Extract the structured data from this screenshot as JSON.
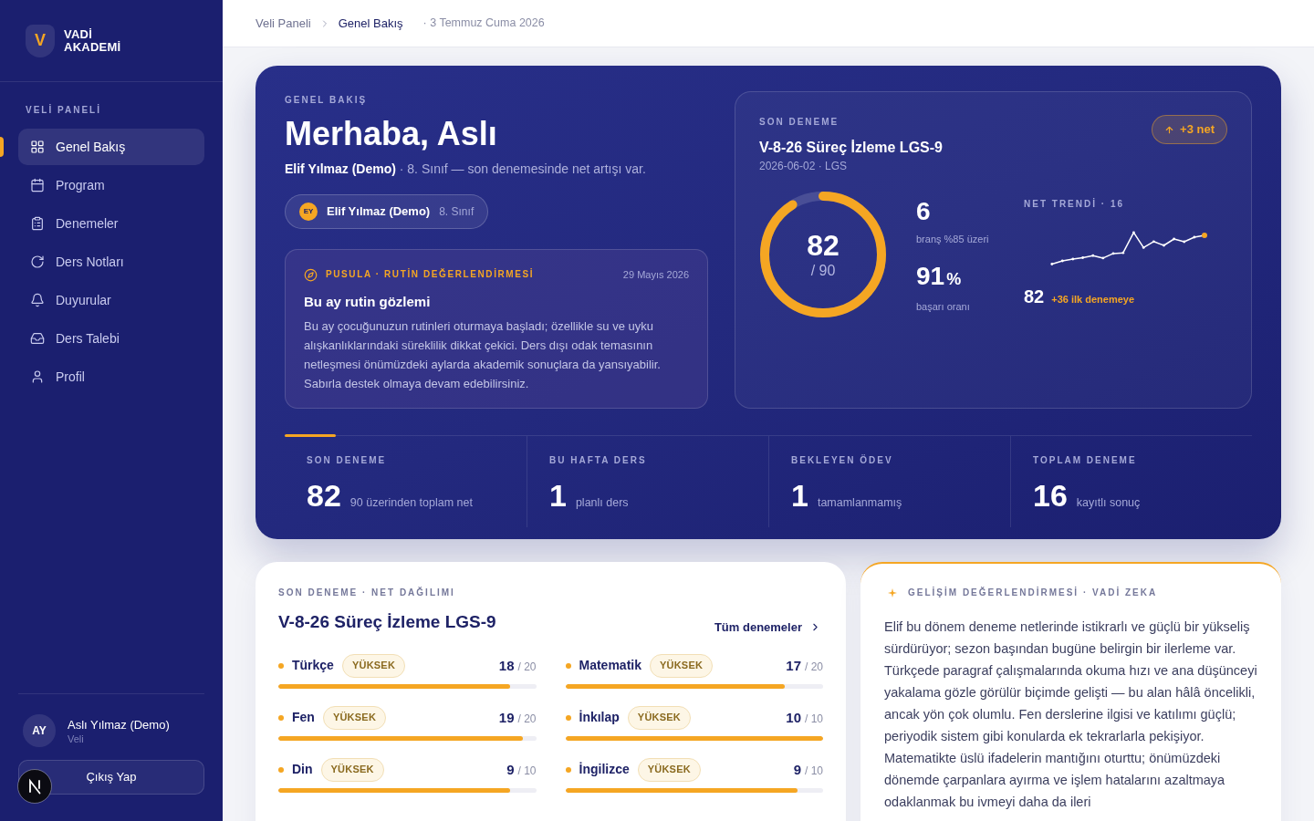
{
  "sidebar": {
    "logo": {
      "mark": "V",
      "name_lines": [
        "VADİ",
        "AKADEMİ"
      ]
    },
    "section_label": "VELİ PANELİ",
    "items": [
      {
        "label": "Genel Bakış",
        "selected": true
      },
      {
        "label": "Program",
        "selected": false
      },
      {
        "label": "Denemeler",
        "selected": false
      },
      {
        "label": "Ders Notları",
        "selected": false
      },
      {
        "label": "Duyurular",
        "selected": false
      },
      {
        "label": "Ders Talebi",
        "selected": false
      },
      {
        "label": "Profil",
        "selected": false
      }
    ],
    "user": {
      "initials": "AY",
      "name": "Aslı Yılmaz (Demo)",
      "role": "Veli"
    },
    "logout_button": "Çıkış Yap"
  },
  "breadcrumb": {
    "items": [
      {
        "label": "Veli Paneli",
        "selected": false
      },
      {
        "label": "Genel Bakış",
        "selected": true
      }
    ],
    "date": "· 3 Temmuz Cuma 2026"
  },
  "hero": {
    "eyebrow": "GENEL BAKIŞ",
    "greeting": "Merhaba, Aslı",
    "subtitle": "**Elif Yılmaz (Demo)** · 8. Sınıf — son denemesinde net artışı var.",
    "student_chip": {
      "initials": "EY",
      "name": "Elif Yılmaz (Demo)",
      "grade": "8. Sınıf"
    },
    "note": {
      "tag": "PUSULA · RUTİN DEĞERLENDİRMESİ",
      "date": "29 Mayıs 2026",
      "title": "Bu ay rutin gözlemi",
      "text": "Bu ay çocuğunuzun rutinleri oturmaya başladı; özellikle su ve uyku alışkanlıklarındaki süreklilik dikkat çekici. Ders dışı odak temasının netleşmesi önümüzdeki aylarda akademik sonuçlara da yansıyabilir. Sabırla destek olmaya devam edebilirsiniz."
    },
    "last_exam": {
      "eyebrow": "SON DENEME",
      "title": "V-8-26 Süreç İzleme LGS-9",
      "meta": "2026-06-02 · LGS",
      "change_badge": "+3 net",
      "ring": {
        "level": 0.911,
        "score": "82",
        "out_of": "/ 90"
      },
      "stats": [
        {
          "value": "6",
          "label": "branş %85 üzeri"
        },
        {
          "value": "91",
          "unit": "%",
          "label": "başarı oranı"
        }
      ],
      "trend": {
        "label": "NET TRENDİ · 16",
        "value": "82",
        "delta": "+36 ilk denemeye"
      }
    },
    "stats": [
      {
        "label": "SON DENEME",
        "value": "82",
        "caption": "90 üzerinden toplam net"
      },
      {
        "label": "BU HAFTA DERS",
        "value": "1",
        "caption": "planlı ders"
      },
      {
        "label": "BEKLEYEN ÖDEV",
        "value": "1",
        "caption": "tamamlanmamış"
      },
      {
        "label": "TOPLAM DENEME",
        "value": "16",
        "caption": "kayıtlı sonuç"
      }
    ]
  },
  "net_distribution": {
    "eyebrow": "SON DENEME · NET DAĞILIMI",
    "title": "V-8-26 Süreç İzleme LGS-9",
    "link": "Tüm denemeler",
    "subjects": [
      {
        "name": "Türkçe",
        "badge": "YÜKSEK",
        "score": "18",
        "out_of": "/ 20",
        "level": 0.9
      },
      {
        "name": "Matematik",
        "badge": "YÜKSEK",
        "score": "17",
        "out_of": "/ 20",
        "level": 0.85
      },
      {
        "name": "Fen",
        "badge": "YÜKSEK",
        "score": "19",
        "out_of": "/ 20",
        "level": 0.95
      },
      {
        "name": "İnkılap",
        "badge": "YÜKSEK",
        "score": "10",
        "out_of": "/ 10",
        "level": 1
      },
      {
        "name": "Din",
        "badge": "YÜKSEK",
        "score": "9",
        "out_of": "/ 10",
        "level": 0.9
      },
      {
        "name": "İngilizce",
        "badge": "YÜKSEK",
        "score": "9",
        "out_of": "/ 10",
        "level": 0.9
      }
    ]
  },
  "assessment": {
    "eyebrow": "GELİŞİM DEĞERLENDİRMESİ · VADİ ZEKA",
    "text": "Elif bu dönem deneme netlerinde istikrarlı ve güçlü bir yükseliş sürdürüyor; sezon başından bugüne belirgin bir ilerleme var. Türkçede paragraf çalışmalarında okuma hızı ve ana düşünceyi yakalama gözle görülür biçimde gelişti — bu alan hâlâ öncelikli, ancak yön çok olumlu. Fen derslerine ilgisi ve katılımı güçlü; periyodik sistem gibi konularda ek tekrarlarla pekişiyor. Matematikte üslü ifadelerin mantığını oturttu; önümüzdeki dönemde çarpanlara ayırma ve işlem hatalarını azaltmaya odaklanmak bu ivmeyi daha da ileri"
  }
}
